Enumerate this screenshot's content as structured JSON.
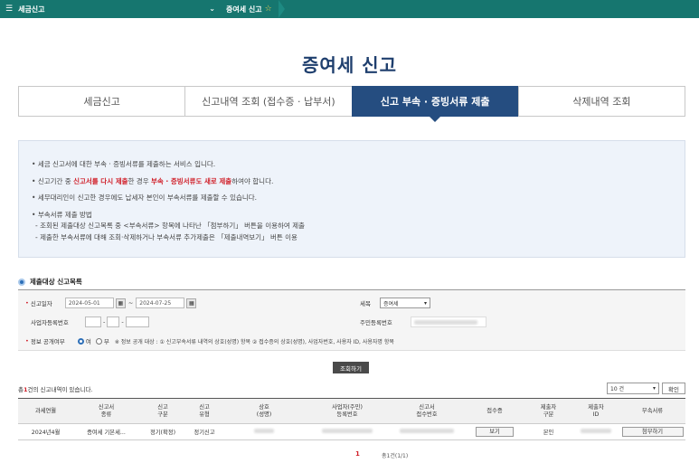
{
  "topbar": {
    "menu_label": "세금신고",
    "breadcrumb": "증여세 신고"
  },
  "page_title": "증여세 신고",
  "tabs": [
    {
      "label": "세금신고",
      "active": false
    },
    {
      "label": "신고내역 조회 (접수증 · 납부서)",
      "active": false
    },
    {
      "label": "신고 부속 · 증빙서류 제출",
      "active": true
    },
    {
      "label": "삭제내역 조회",
      "active": false
    }
  ],
  "notice": {
    "line1": "세금 신고서에 대한 부속 · 증빙서류를 제출하는 서비스 입니다.",
    "line2_a": "신고기간 중 ",
    "line2_b": "신고서를 다시 제출",
    "line2_c": "한 경우 ",
    "line2_d": "부속 · 증빙서류도 새로 제출",
    "line2_e": "하여야 합니다.",
    "line3": "세무대리인이 신고한 경우에도 납세자 본인이 부속서류를 제출할 수 있습니다.",
    "line4": "부속서류 제출 방법",
    "line5": "- 조회된 제출대상 신고목록 중 <부속서류> 항목에 나타난 「첨부하기」 버튼을 이용하여 제출",
    "line6": "- 제출한 부속서류에 대해 조회·삭제하거나 부속서류 추가제출은 「제출내역보기」 버튼 이용"
  },
  "section_title": "제출대상 신고목록",
  "form": {
    "date_label": "신고일자",
    "date_from": "2024-05-01",
    "date_to": "2024-07-25",
    "date_sep": "~",
    "tax_label": "세목",
    "tax_value": "증여세",
    "bizno_label": "사업자등록번호",
    "resno_label": "주민등록번호",
    "disclose_label": "정보 공개여부",
    "radio_yes": "여",
    "radio_no": "부",
    "disclose_note": "※ 정보 공개 대상 : ① 신고부속서류 내역의 상호(성명) 항목 ② 접수증의 상호(성명), 사업자번호, 사용자 ID, 사용자명 항목"
  },
  "search_button": "조회하기",
  "results": {
    "count_prefix": "총",
    "count_num": "1",
    "count_suffix": "건의 신고내역이 있습니다.",
    "page_size": "10 건",
    "confirm_button": "확인"
  },
  "table": {
    "headers": [
      [
        "과세연월"
      ],
      [
        "신고서",
        "종류"
      ],
      [
        "신고",
        "구분"
      ],
      [
        "신고",
        "유형"
      ],
      [
        "상호",
        "(성명)"
      ],
      [
        "사업자(주민)",
        "등록번호"
      ],
      [
        "신고서",
        "접수번호"
      ],
      [
        "접수증"
      ],
      [
        "제출자",
        "구분"
      ],
      [
        "제출자",
        "ID"
      ],
      [
        "부속서류"
      ]
    ],
    "rows": [
      {
        "period": "2024년4월",
        "kind": "증여세 기본세...",
        "category": "정기(확정)",
        "type": "정기신고",
        "view_button": "보기",
        "submitter": "본인",
        "attach_button": "첨부하기"
      }
    ]
  },
  "pagination": {
    "current": "1",
    "info": "총1건(1/1)"
  },
  "colors": {
    "topbar": "#16766f",
    "active_tab": "#254d80",
    "title": "#1f3f6e",
    "accent_red": "#d0202a"
  }
}
